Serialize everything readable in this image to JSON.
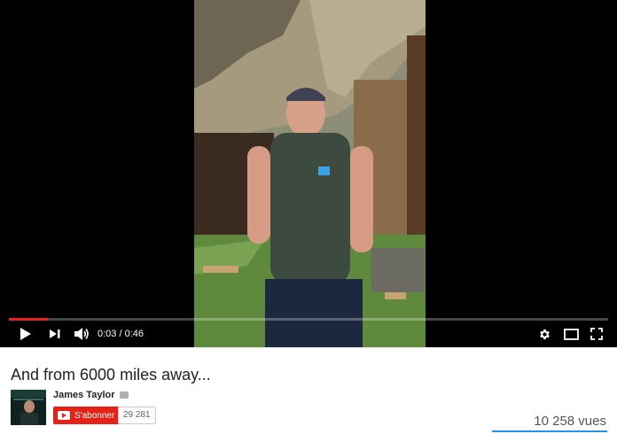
{
  "player": {
    "time_current": "0:03",
    "time_separator": " / ",
    "time_total": "0:46",
    "progress_fraction": 0.065,
    "icons": {
      "play": "play-icon",
      "next": "next-icon",
      "volume": "volume-icon",
      "settings": "gear-icon",
      "theater": "theater-mode-icon",
      "fullscreen": "fullscreen-icon"
    },
    "accent_color": "#e62117"
  },
  "video": {
    "title": "And from 6000 miles away...",
    "channel_name": "James Taylor",
    "subscribe_label": "S'abonner",
    "subscriber_count": "29 281",
    "view_count": "10 258 vues"
  }
}
